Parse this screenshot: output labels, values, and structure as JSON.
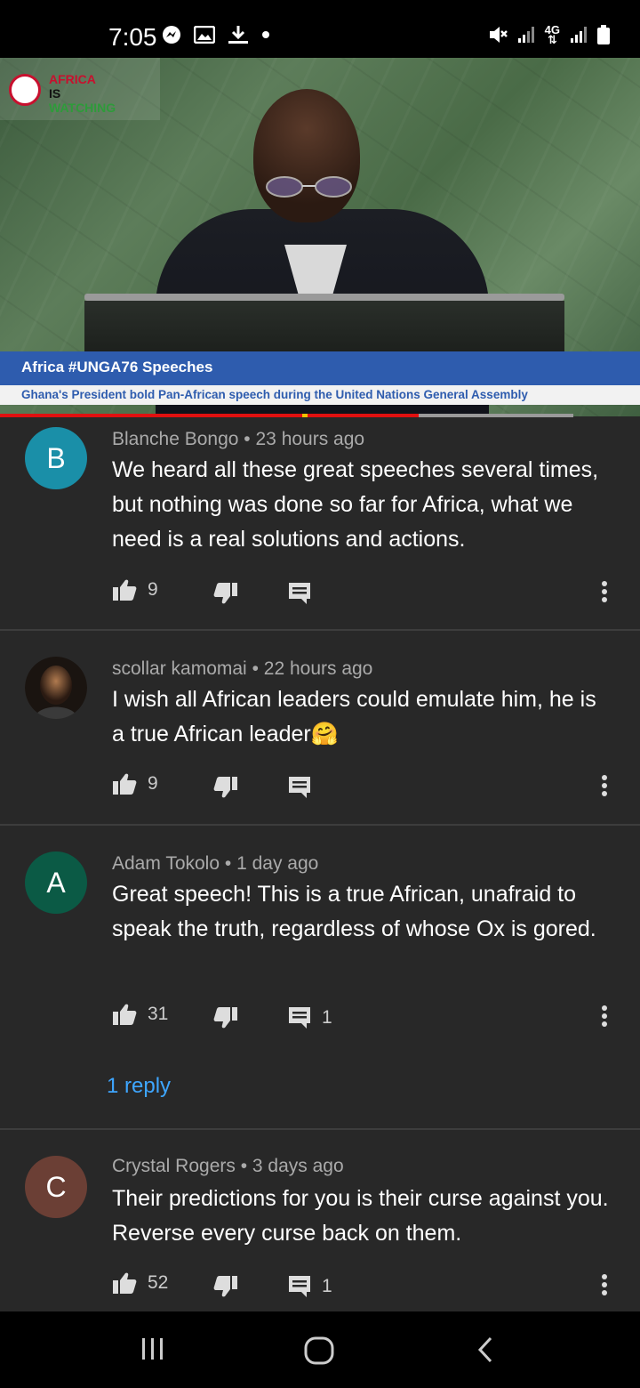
{
  "status_bar": {
    "time": "7:05",
    "left_icons": [
      "messenger-icon",
      "gallery-icon",
      "download-icon",
      "dot-icon"
    ],
    "right_icons": [
      "mute-icon",
      "signal-icon",
      "4g-icon",
      "signal-icon",
      "battery-icon"
    ],
    "network_label": "4G"
  },
  "video": {
    "channel_logo": [
      "AFRICA",
      "IS",
      "WATCHING"
    ],
    "banner_title": "Africa #UNGA76 Speeches",
    "banner_subtitle": "Ghana's President bold Pan-African speech during the United Nations General Assembly",
    "progress_fraction": 0.73
  },
  "comments": [
    {
      "avatar_letter": "B",
      "avatar_color": "#1a8fa8",
      "author": "Blanche Bongo",
      "time": "23 hours ago",
      "text": "We heard all these great speeches several times, but nothing was done so far for Africa, what we need is a real solutions and actions.",
      "likes": "9",
      "replies": ""
    },
    {
      "avatar_letter": "",
      "avatar_color": "#3a2a22",
      "author": "scollar kamomai",
      "time": "22 hours ago",
      "text": "I wish all African leaders could emulate him, he is a true African leader🤗",
      "likes": "9",
      "replies": ""
    },
    {
      "avatar_letter": "A",
      "avatar_color": "#0b5a45",
      "author": "Adam Tokolo",
      "time": "1 day ago",
      "text": "Great speech! This is a true African, unafraid to speak the truth, regardless of whose Ox is gored.",
      "likes": "31",
      "replies": "1",
      "reply_link": "1 reply"
    },
    {
      "avatar_letter": "C",
      "avatar_color": "#6b3f35",
      "author": "Crystal Rogers",
      "time": "3 days ago",
      "text": "Their predictions for you is their curse against you. Reverse every curse back on them.",
      "likes": "52",
      "replies": "1"
    }
  ],
  "meta_separator": "•",
  "nav_bar": {
    "buttons": [
      "recent-apps-icon",
      "home-icon",
      "back-icon"
    ]
  }
}
